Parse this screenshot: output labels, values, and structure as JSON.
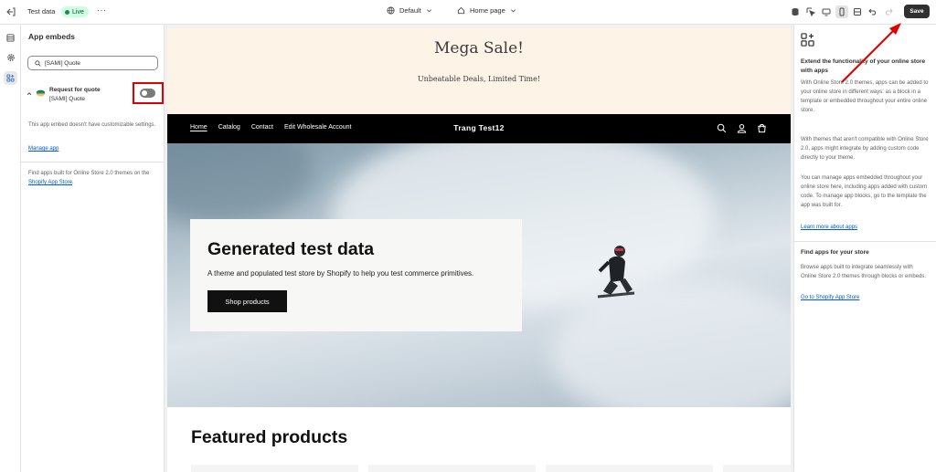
{
  "topbar": {
    "title": "Test data",
    "live_badge": "Live",
    "more_label": "···",
    "theme_label": "Default",
    "page_label": "Home page",
    "save_label": "Save"
  },
  "sidebar": {
    "heading": "App embeds",
    "search_value": "[SAMI] Quote",
    "embed": {
      "title": "Request for quote",
      "subtitle": "[SAMI] Quote",
      "enabled": false
    },
    "no_settings_note": "This app embed doesn't have customizable settings.",
    "manage_app": "Manage app",
    "find_apps_text": "Find apps built for Online Store 2.0 themes on the",
    "find_apps_link": "Shopify App Store",
    "find_apps_end": "."
  },
  "preview": {
    "announcement_title": "Mega Sale!",
    "announcement_sub": "Unbeatable Deals, Limited Time!",
    "nav_links": [
      "Home",
      "Catalog",
      "Contact",
      "Edit Wholesale Account"
    ],
    "brand": "Trang Test12",
    "hero_heading": "Generated test data",
    "hero_text": "A theme and populated test store by Shopify to help you test commerce primitives.",
    "hero_button": "Shop products",
    "featured_title": "Featured products"
  },
  "right_panel": {
    "heading": "Extend the functionality of your online store with apps",
    "p1": "With Online Store 2.0 themes, apps can be added to your online store in different ways: as a block in a template or embedded throughout your entire online store.",
    "p2": "With themes that aren't compatible with Online Store 2.0, apps might integrate by adding custom code directly to your theme.",
    "p3": "You can manage apps embedded throughout your online store here, including apps added with custom code. To manage app blocks, go to the template the app was built for.",
    "learn_more": "Learn more about apps",
    "find_heading": "Find apps for your store",
    "find_text": "Browse apps built to integrate seamlessly with Online Store 2.0 themes through blocks or embeds.",
    "store_link": "Go to Shopify App Store"
  },
  "colors": {
    "accent_link": "#005bd3",
    "live_green": "#29845a",
    "highlight_red": "#e00000",
    "save_dark": "#303030"
  }
}
